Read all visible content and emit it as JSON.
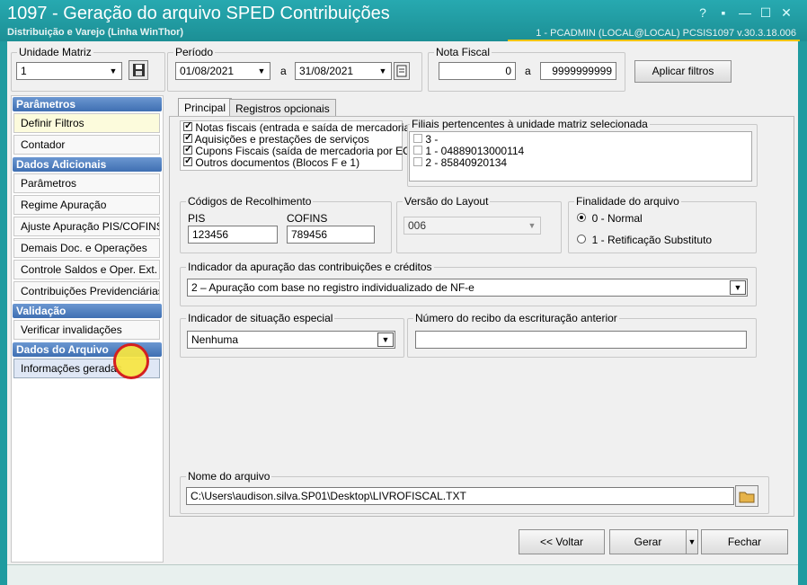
{
  "window": {
    "title": "1097 - Geração do arquivo SPED Contribuições",
    "subtitle": "Distribuição e Varejo (Linha WinThor)",
    "session": "1 - PCADMIN (LOCAL@LOCAL)   PCSIS1097  v.30.3.18.006",
    "controls": {
      "help": "?",
      "restore_small": "▪",
      "minimize": "—",
      "maximize": "☐",
      "close": "✕"
    }
  },
  "filters": {
    "unidade_matriz": {
      "label": "Unidade Matriz",
      "value": "1"
    },
    "periodo": {
      "label": "Período",
      "start": "01/08/2021",
      "separator": "a",
      "end": "31/08/2021"
    },
    "nota_fiscal": {
      "label": "Nota Fiscal",
      "from": "0",
      "separator": "a",
      "to": "9999999999"
    },
    "apply_button": "Aplicar filtros"
  },
  "sidebar": {
    "sections": [
      {
        "header": "Parâmetros",
        "items": [
          "Definir Filtros",
          "Contador"
        ]
      },
      {
        "header": "Dados Adicionais",
        "items": [
          "Parâmetros",
          "Regime Apuração",
          "Ajuste Apuração PIS/COFINS",
          "Demais Doc. e Operações",
          "Controle Saldos e Oper. Ext.",
          "Contribuições Previdenciárias"
        ]
      },
      {
        "header": "Validação",
        "items": [
          "Verificar invalidações"
        ]
      },
      {
        "header": "Dados do Arquivo",
        "items": [
          "Informações geradas"
        ]
      }
    ]
  },
  "tabs": [
    "Principal",
    "Registros opcionais"
  ],
  "documents": [
    {
      "label": "Notas fiscais (entrada e saída de mercadoria)",
      "checked": true
    },
    {
      "label": "Aquisições e prestações de serviços",
      "checked": true
    },
    {
      "label": "Cupons Fiscais (saída de mercadoria por ECF)",
      "checked": true
    },
    {
      "label": "Outros documentos (Blocos F e 1)",
      "checked": true
    }
  ],
  "filiais": {
    "label": "Filiais pertencentes à unidade matriz selecionada",
    "items": [
      {
        "label": "3 -",
        "checked": false
      },
      {
        "label": "1 - 04889013000114",
        "checked": false
      },
      {
        "label": "2 - 85840920134",
        "checked": false
      }
    ]
  },
  "codigos": {
    "label": "Códigos de Recolhimento",
    "pis_label": "PIS",
    "pis": "123456",
    "cofins_label": "COFINS",
    "cofins": "789456"
  },
  "versao": {
    "label": "Versão do Layout",
    "value": "006"
  },
  "finalidade": {
    "label": "Finalidade do arquivo",
    "options": [
      "0 - Normal",
      "1 - Retificação Substituto"
    ],
    "selected": 0
  },
  "indicador_apuracao": {
    "label": "Indicador da apuração das contribuições e créditos",
    "value": "2 – Apuração com base no registro individualizado de NF-e"
  },
  "indicador_situacao": {
    "label": "Indicador de situação especial",
    "value": "Nenhuma"
  },
  "recibo": {
    "label": "Número do recibo da escrituração anterior",
    "value": ""
  },
  "arquivo": {
    "label": "Nome do arquivo",
    "value": "C:\\Users\\audison.silva.SP01\\Desktop\\LIVROFISCAL.TXT"
  },
  "buttons": {
    "voltar": "<< Voltar",
    "gerar": "Gerar",
    "fechar": "Fechar"
  },
  "colors": {
    "titlebar": "#1f9ba0",
    "accent": "#f2c500",
    "section_header": "#3f6fb2",
    "cursor_highlight": "#f7e640",
    "cursor_ring": "#d42020"
  }
}
